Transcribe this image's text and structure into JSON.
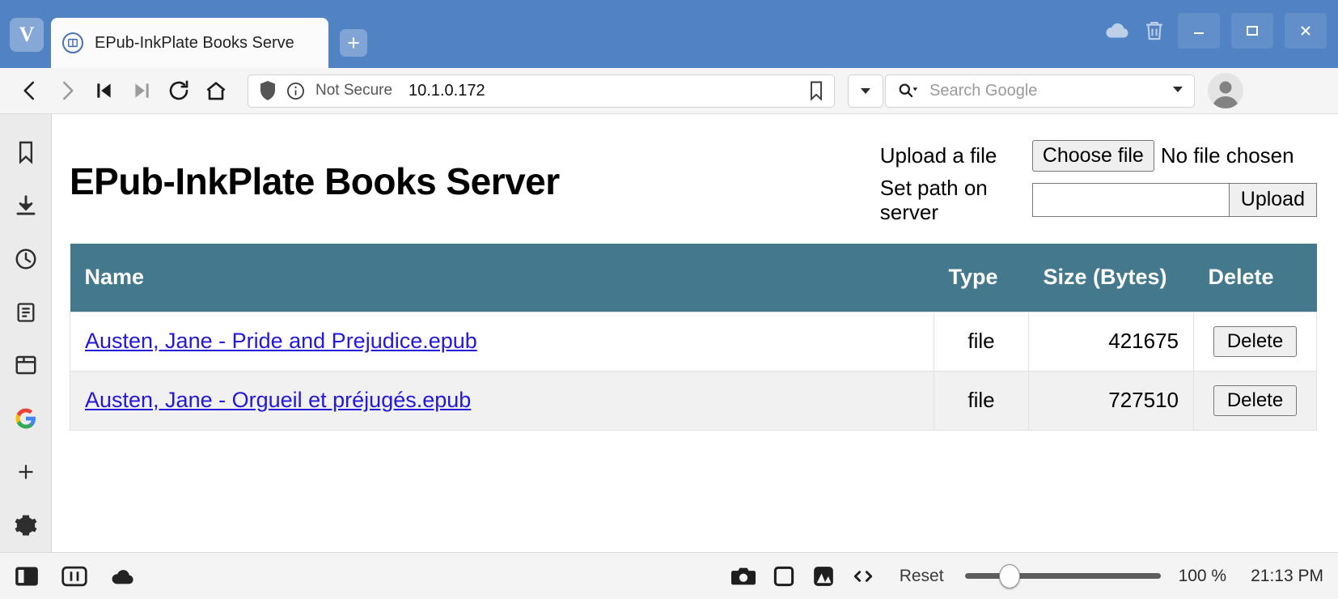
{
  "window": {
    "browser_logo": "V",
    "sync_icon": "cloud-icon",
    "trash_icon": "trash-icon",
    "minimize": "minimize-icon",
    "maximize": "maximize-icon",
    "close": "close-icon"
  },
  "tabs": [
    {
      "title": "EPub-InkPlate Books Serve",
      "favicon": "page-favicon"
    }
  ],
  "newtab_label": "+",
  "navbar": {
    "back": "back-icon",
    "forward": "forward-icon",
    "rewind": "rewind-icon",
    "fastforward": "fast-forward-icon",
    "reload": "reload-icon",
    "home": "home-icon",
    "security_label": "Not Secure",
    "url": "10.1.0.172",
    "bookmark_icon": "bookmark-icon",
    "dropdown_icon": "chevron-down-icon",
    "search_placeholder": "Search Google",
    "search_icon": "search-icon",
    "profile_icon": "avatar-icon"
  },
  "sidebar": {
    "items": [
      {
        "name": "bookmarks",
        "icon": "bookmark-icon"
      },
      {
        "name": "downloads",
        "icon": "download-icon"
      },
      {
        "name": "history",
        "icon": "clock-icon"
      },
      {
        "name": "notes",
        "icon": "notes-icon"
      },
      {
        "name": "windows",
        "icon": "window-icon"
      },
      {
        "name": "google",
        "icon": "google-icon"
      },
      {
        "name": "add-panel",
        "icon": "plus-icon"
      },
      {
        "name": "settings",
        "icon": "gear-icon"
      }
    ]
  },
  "page": {
    "title": "EPub-InkPlate Books Server",
    "upload": {
      "file_label": "Upload a file",
      "choose_file_button": "Choose file",
      "no_file_text": "No file chosen",
      "path_label": "Set path on server",
      "path_value": "",
      "upload_button": "Upload"
    },
    "table": {
      "headers": [
        "Name",
        "Type",
        "Size (Bytes)",
        "Delete"
      ],
      "rows": [
        {
          "name": "Austen, Jane - Pride and Prejudice.epub",
          "type": "file",
          "size": "421675",
          "delete_label": "Delete"
        },
        {
          "name": "Austen, Jane - Orgueil et préjugés.epub",
          "type": "file",
          "size": "727510",
          "delete_label": "Delete"
        }
      ]
    },
    "colors": {
      "table_header_bg": "#44788c",
      "link": "#2318d8",
      "row_alt_bg": "#f1f1f1"
    }
  },
  "statusbar": {
    "panel_toggle": "panel-toggle-icon",
    "tile_view": "tile-view-icon",
    "cloud": "cloud-icon",
    "capture_page": "camera-icon",
    "capture_area": "capture-area-icon",
    "image_toggle": "image-icon",
    "code_toggle": "code-icon",
    "reset_label": "Reset",
    "zoom_percent": "100 %",
    "clock": "21:13 PM"
  }
}
